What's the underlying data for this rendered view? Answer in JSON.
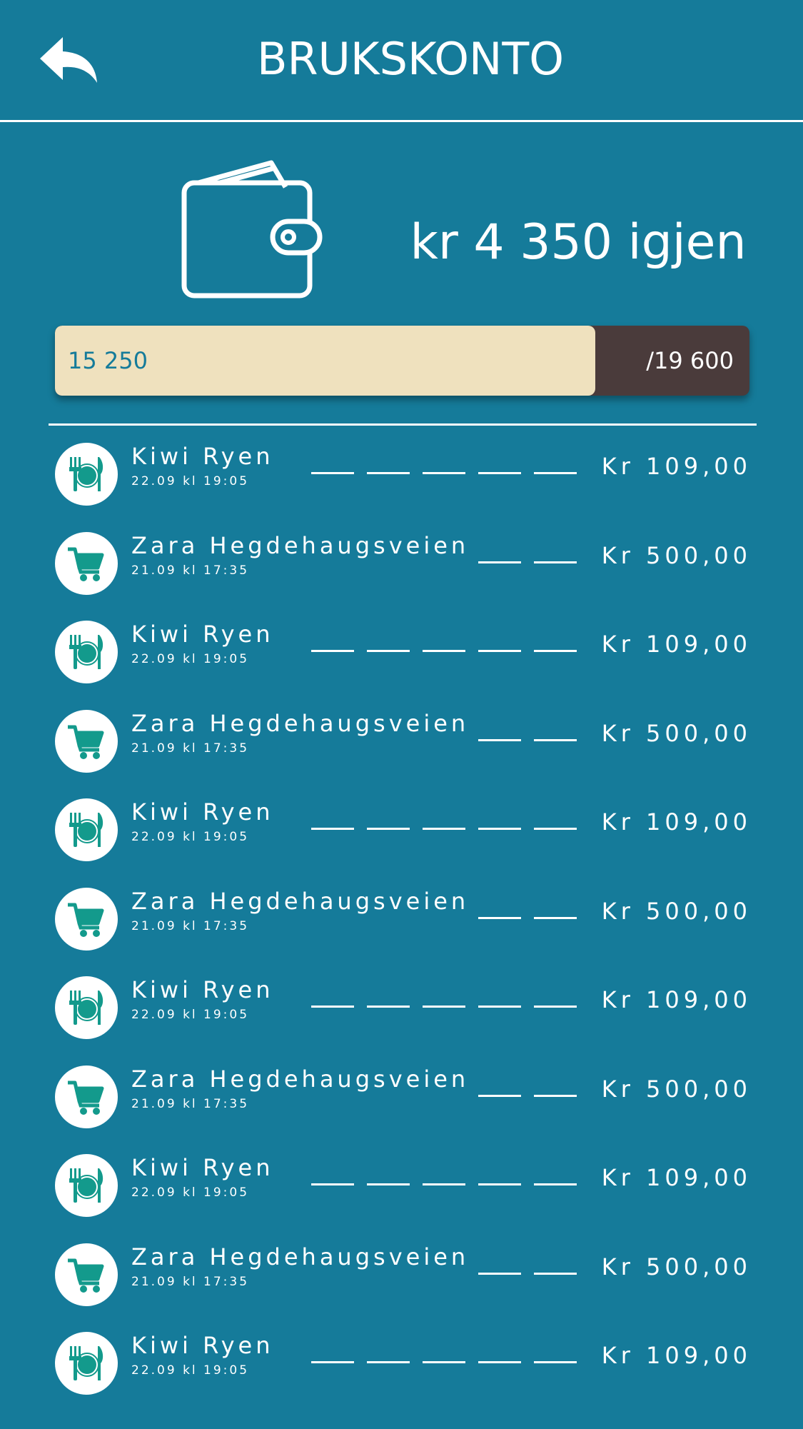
{
  "header": {
    "title": "BRUKSKONTO",
    "back_icon": "back-arrow-icon"
  },
  "balance": {
    "wallet_icon": "wallet-icon",
    "remaining_text": "kr 4 350 igjen",
    "spent_label": "15 250",
    "total_label": "/19 600",
    "spent": 15250,
    "total": 19600
  },
  "colors": {
    "background": "#157b9a",
    "bar_fill": "#efe1be",
    "bar_track": "#4a3b3b",
    "icon_accent": "#139a8c"
  },
  "transactions": [
    {
      "merchant": "Kiwi Ryen",
      "datetime": "22.09 kl 19:05",
      "amount": "Kr 109,00",
      "icon": "restaurant-icon",
      "dashes": 5
    },
    {
      "merchant": "Zara Hegdehaugsveien",
      "datetime": "21.09 kl 17:35",
      "amount": "Kr 500,00",
      "icon": "shopping-cart-icon",
      "dashes": 2
    },
    {
      "merchant": "Kiwi Ryen",
      "datetime": "22.09 kl 19:05",
      "amount": "Kr 109,00",
      "icon": "restaurant-icon",
      "dashes": 5
    },
    {
      "merchant": "Zara Hegdehaugsveien",
      "datetime": "21.09 kl 17:35",
      "amount": "Kr 500,00",
      "icon": "shopping-cart-icon",
      "dashes": 2
    },
    {
      "merchant": "Kiwi Ryen",
      "datetime": "22.09 kl 19:05",
      "amount": "Kr 109,00",
      "icon": "restaurant-icon",
      "dashes": 5
    },
    {
      "merchant": "Zara Hegdehaugsveien",
      "datetime": "21.09 kl 17:35",
      "amount": "Kr 500,00",
      "icon": "shopping-cart-icon",
      "dashes": 2
    },
    {
      "merchant": "Kiwi Ryen",
      "datetime": "22.09 kl 19:05",
      "amount": "Kr 109,00",
      "icon": "restaurant-icon",
      "dashes": 5
    },
    {
      "merchant": "Zara Hegdehaugsveien",
      "datetime": "21.09 kl 17:35",
      "amount": "Kr 500,00",
      "icon": "shopping-cart-icon",
      "dashes": 2
    },
    {
      "merchant": "Kiwi Ryen",
      "datetime": "22.09 kl 19:05",
      "amount": "Kr 109,00",
      "icon": "restaurant-icon",
      "dashes": 5
    },
    {
      "merchant": "Zara Hegdehaugsveien",
      "datetime": "21.09 kl 17:35",
      "amount": "Kr 500,00",
      "icon": "shopping-cart-icon",
      "dashes": 2
    },
    {
      "merchant": "Kiwi Ryen",
      "datetime": "22.09 kl 19:05",
      "amount": "Kr 109,00",
      "icon": "restaurant-icon",
      "dashes": 5
    }
  ]
}
